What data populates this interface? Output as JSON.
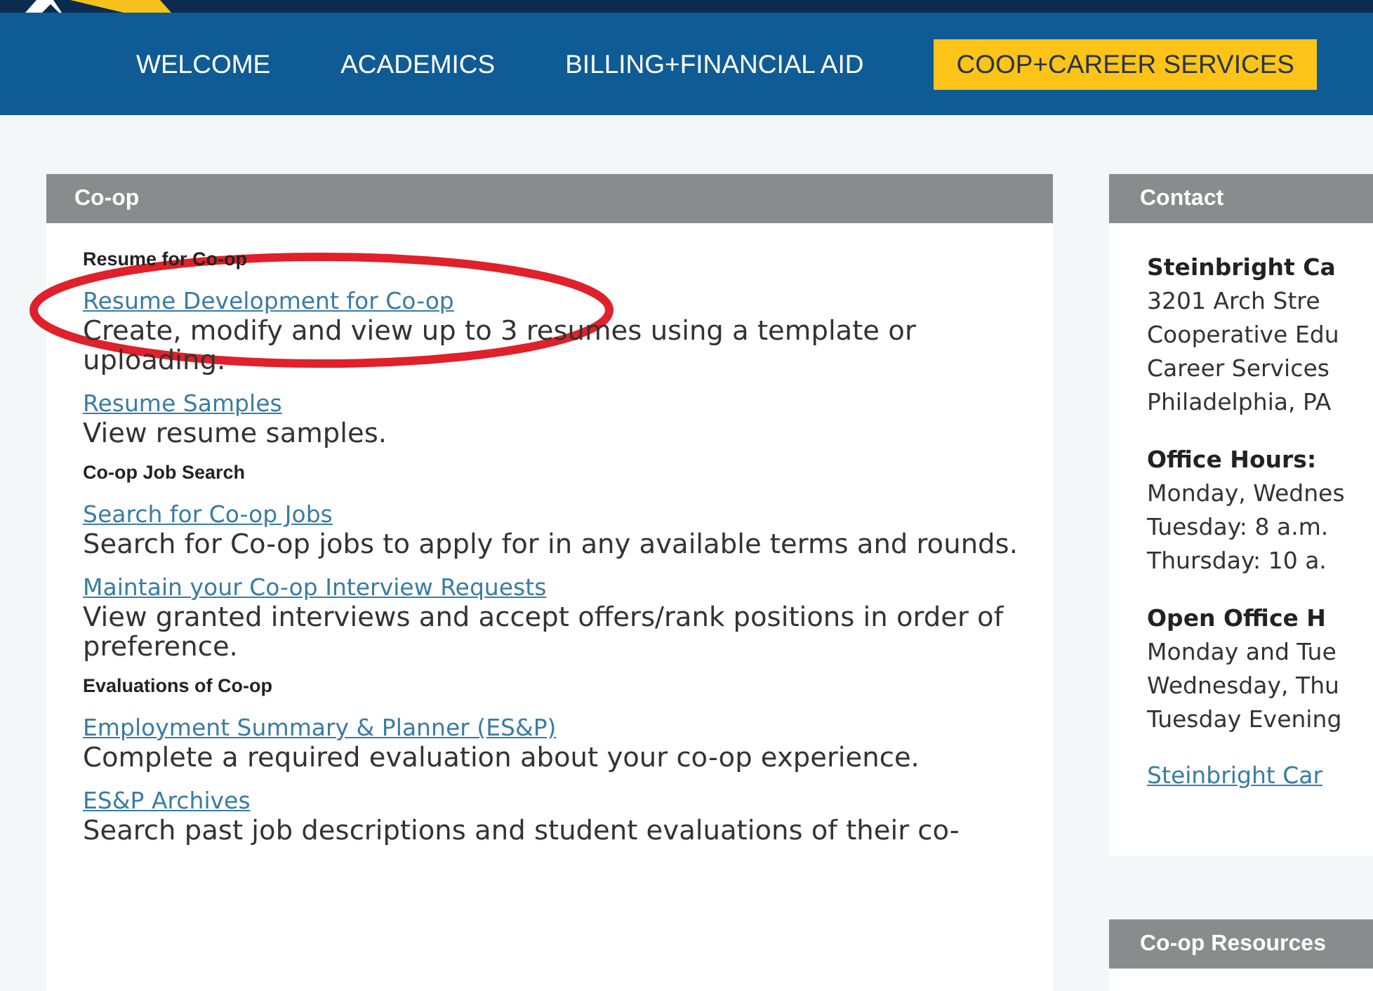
{
  "nav": [
    {
      "label": "WELCOME",
      "selected": false
    },
    {
      "label": "ACADEMICS",
      "selected": false
    },
    {
      "label": "BILLING+FINANCIAL AID",
      "selected": false
    },
    {
      "label": "COOP+CAREER SERVICES",
      "selected": true
    }
  ],
  "main_panel": {
    "title": "Co-op",
    "sections": [
      {
        "heading": "Resume for Co-op",
        "items": [
          {
            "link": "Resume Development for Co-op",
            "description": "Create, modify and view up to 3 resumes using a template or uploading.",
            "circled": true
          },
          {
            "link": "Resume Samples",
            "description": "View resume samples.",
            "circled": false
          }
        ]
      },
      {
        "heading": "Co-op Job Search",
        "items": [
          {
            "link": "Search for Co-op Jobs",
            "description": "Search for Co-op jobs to apply for in any available terms and rounds.",
            "circled": false
          },
          {
            "link": "Maintain your Co-op Interview Requests",
            "description": "View granted interviews and accept offers/rank positions in order of preference.",
            "circled": false
          }
        ]
      },
      {
        "heading": "Evaluations of Co-op",
        "items": [
          {
            "link": "Employment Summary & Planner (ES&P)",
            "description": "Complete a required evaluation about your co-op experience.",
            "circled": false
          },
          {
            "link": "ES&P Archives",
            "description": "Search past job descriptions and student evaluations of their co-",
            "circled": false
          }
        ]
      }
    ]
  },
  "contact_panel": {
    "title": "Contact",
    "blocks": [
      {
        "heading": "Steinbright Ca",
        "lines": [
          "3201 Arch Stre",
          "Cooperative Edu",
          "Career Services",
          "Philadelphia, PA"
        ]
      },
      {
        "heading": "Office Hours:",
        "lines": [
          "Monday, Wednes",
          "Tuesday: 8 a.m.",
          "Thursday: 10 a."
        ]
      },
      {
        "heading": "Open Office H",
        "lines": [
          "Monday and Tue",
          "Wednesday, Thu",
          "Tuesday Evening"
        ]
      }
    ],
    "link": "Steinbright Car"
  },
  "resources_panel": {
    "title": "Co-op Resources"
  }
}
